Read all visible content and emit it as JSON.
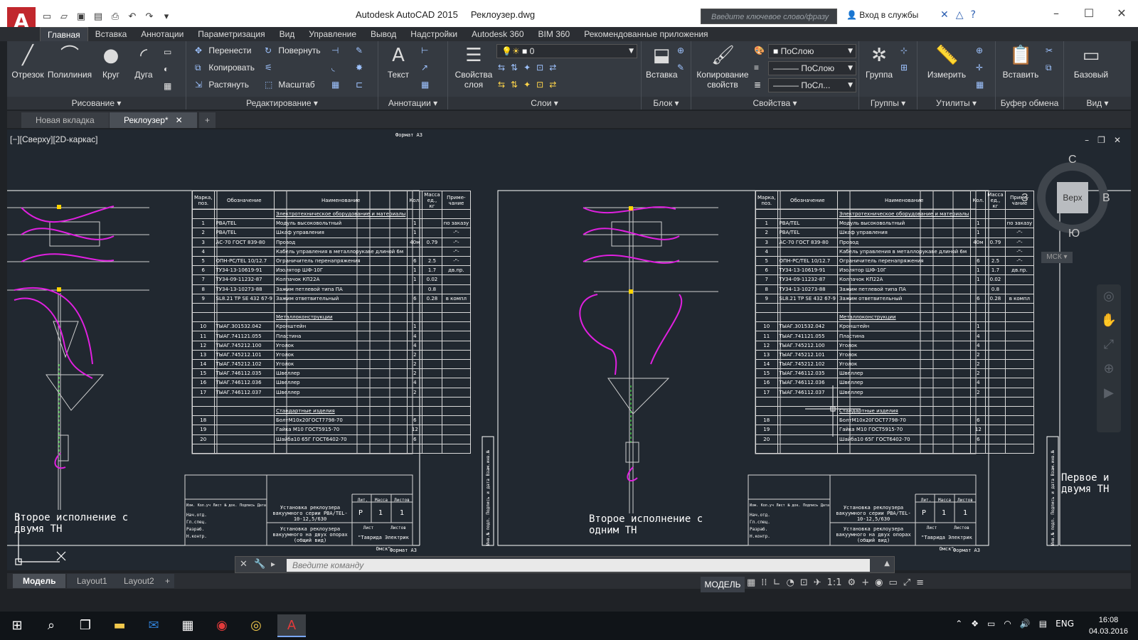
{
  "app": {
    "logo": "A",
    "title": "Autodesk AutoCAD 2015",
    "document": "Реклоузер.dwg",
    "search_placeholder": "Введите ключевое слово/фразу",
    "login": "Вход в службы"
  },
  "ribbon_tabs": [
    "Главная",
    "Вставка",
    "Аннотации",
    "Параметризация",
    "Вид",
    "Управление",
    "Вывод",
    "Надстройки",
    "Autodesk 360",
    "BIM 360",
    "Рекомендованные приложения"
  ],
  "panels": {
    "draw": {
      "title": "Рисование",
      "tools": [
        "Отрезок",
        "Полилиния",
        "Круг",
        "Дуга"
      ]
    },
    "modify": {
      "title": "Редактирование",
      "tools": [
        "Перенести",
        "Повернуть",
        "Копировать",
        "Растянуть",
        "Масштаб"
      ]
    },
    "annotation": {
      "title": "Аннотации",
      "tools": [
        "Текст"
      ]
    },
    "layers": {
      "title": "Слои",
      "tools": [
        "Свойства слоя"
      ],
      "current_layer": "0"
    },
    "block": {
      "title": "Блок",
      "tools": [
        "Вставка"
      ]
    },
    "properties": {
      "title": "Свойства",
      "tools": [
        "Копирование свойств"
      ],
      "color": "ПоСлою",
      "linetype": "ПоСлою",
      "lineweight": "ПоСл..."
    },
    "groups": {
      "title": "Группы",
      "tools": [
        "Группа"
      ]
    },
    "utilities": {
      "title": "Утилиты",
      "tools": [
        "Измерить"
      ]
    },
    "clipboard": {
      "title": "Буфер обмена",
      "tools": [
        "Вставить"
      ]
    },
    "view": {
      "title": "Вид",
      "tools": [
        "Базовый"
      ]
    }
  },
  "file_tabs": [
    "Новая вкладка",
    "Реклоузер*"
  ],
  "viewport": {
    "label": "[−][Сверху][2D-каркас]",
    "viewcube": {
      "face": "Верх",
      "north": "С",
      "south": "Ю",
      "west": "З",
      "east": "В"
    },
    "ucs": "МСК"
  },
  "drawing": {
    "format_label": "Формат А3",
    "sheet1_caption": "Второе исполнение с двумя ТН",
    "sheet2_caption": "Второе исполнение с одним ТН",
    "sheet3_caption": "Первое и двумя ТН",
    "table_headers": [
      "Марка, поз.",
      "Обозначение",
      "Наименование",
      "Кол.",
      "Масса ед., кг",
      "Приме-чание"
    ],
    "sections": [
      "Электротехническое оборудование и материалы",
      "Металлоконструкции",
      "Стандартные изделия"
    ],
    "rows": [
      [
        "1",
        "PBA/TEL",
        "Модуль высоковольтный",
        "1",
        "",
        "по заказу"
      ],
      [
        "2",
        "PBA/TEL",
        "Шкаф управления",
        "1",
        "",
        "-\"-"
      ],
      [
        "3",
        "АС-70 ГОСТ 839-80",
        "Провод",
        "40м",
        "0.79",
        "-\"-"
      ],
      [
        "4",
        "",
        "Кабель управления в металлорукаве длиной 6м",
        "",
        "",
        "-\"-"
      ],
      [
        "5",
        "ОПН-РС/TEL 10/12.7",
        "Ограничитель перенапряжения",
        "6",
        "2.5",
        "-\"-"
      ],
      [
        "6",
        "ТУ34-13-10619-91",
        "Изолятор ШФ-10Г",
        "1",
        "1.7",
        "дв.пр."
      ],
      [
        "7",
        "ТУ34-09-11232-87",
        "Колпачок КП22А",
        "1",
        "0.02",
        ""
      ],
      [
        "8",
        "ТУ34-13-10273-88",
        "Зажим петлевой типа ПА",
        "",
        "0.8",
        ""
      ],
      [
        "9",
        "SL8.21 TP SE 432 67-9",
        "Зажим ответвительный",
        "6",
        "0.28",
        "в компл"
      ],
      [
        "10",
        "ТЫАГ.301532.042",
        "Кронштейн",
        "1",
        "",
        ""
      ],
      [
        "11",
        "ТЫАГ.741121.055",
        "Пластина",
        "4",
        "",
        ""
      ],
      [
        "12",
        "ТЫАГ.745212.100",
        "Уголок",
        "4",
        "",
        ""
      ],
      [
        "13",
        "ТЫАГ.745212.101",
        "Уголок",
        "2",
        "",
        ""
      ],
      [
        "14",
        "ТЫАГ.745212.102",
        "Уголок",
        "2",
        "",
        ""
      ],
      [
        "15",
        "ТЫАГ.746112.035",
        "Швеллер",
        "2",
        "",
        ""
      ],
      [
        "16",
        "ТЫАГ.746112.036",
        "Швеллер",
        "4",
        "",
        ""
      ],
      [
        "17",
        "ТЫАГ.746112.037",
        "Швеллер",
        "2",
        "",
        ""
      ],
      [
        "18",
        "",
        "БолтМ10х20ГОСТ7798-70",
        "6",
        "",
        ""
      ],
      [
        "19",
        "",
        "Гайка М10 ГОСТ5915-70",
        "12",
        "",
        ""
      ],
      [
        "20",
        "",
        "Шайба10 65Г ГОСТ6402-70",
        "6",
        "",
        ""
      ]
    ],
    "stamp": {
      "title": "Установка реклоузера вакуумного серии PBA/TEL-10-12,5/630",
      "subtitle": "Установка реклоузера вакуумного на двух опорах (общий вид)",
      "company": "\"Таврида Электрик Омск\"",
      "stage": "Р",
      "sheet": "1",
      "sheets": "1",
      "roles": [
        "Разраб.",
        "Н.контр.",
        "Нач.отд.",
        "Гл.спец."
      ],
      "cols": [
        "Изм.",
        "Кол.уч",
        "Лист",
        "№ док.",
        "Подпись",
        "Дата"
      ],
      "head": [
        "Лит.",
        "Масса",
        "Листов"
      ],
      "sheet_label": "Лист",
      "sheet_label2": "Листов"
    },
    "side_stamp": "Инв.№ подл. Подпись и дата Взам.инв.№"
  },
  "command": {
    "placeholder": "Введите команду"
  },
  "layout_tabs": [
    "Модель",
    "Layout1",
    "Layout2"
  ],
  "status": {
    "model": "МОДЕЛЬ",
    "scale": "1:1"
  },
  "taskbar": {
    "lang": "ENG",
    "time": "16:08",
    "date": "04.03.2016"
  }
}
